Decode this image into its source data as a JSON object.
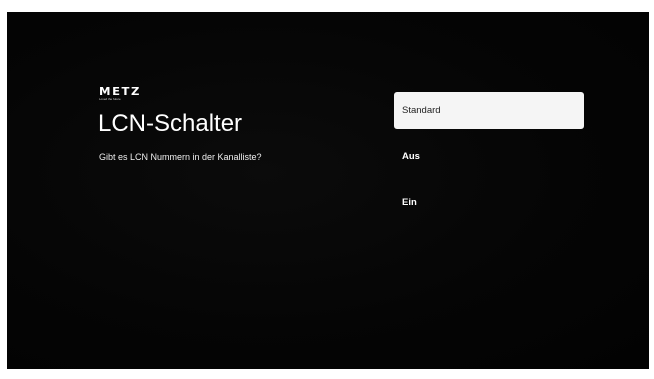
{
  "brand": {
    "name": "METZ",
    "tagline": "Loved the future"
  },
  "page": {
    "title": "LCN-Schalter",
    "subtitle": "Gibt es LCN Nummern in der Kanalliste?"
  },
  "options": [
    {
      "label": "Standard",
      "selected": true
    },
    {
      "label": "Aus",
      "selected": false
    },
    {
      "label": "Ein",
      "selected": false
    }
  ],
  "colors": {
    "background": "#050505",
    "text": "#ffffff",
    "selected_background": "#f5f5f5",
    "selected_text": "#222222"
  }
}
